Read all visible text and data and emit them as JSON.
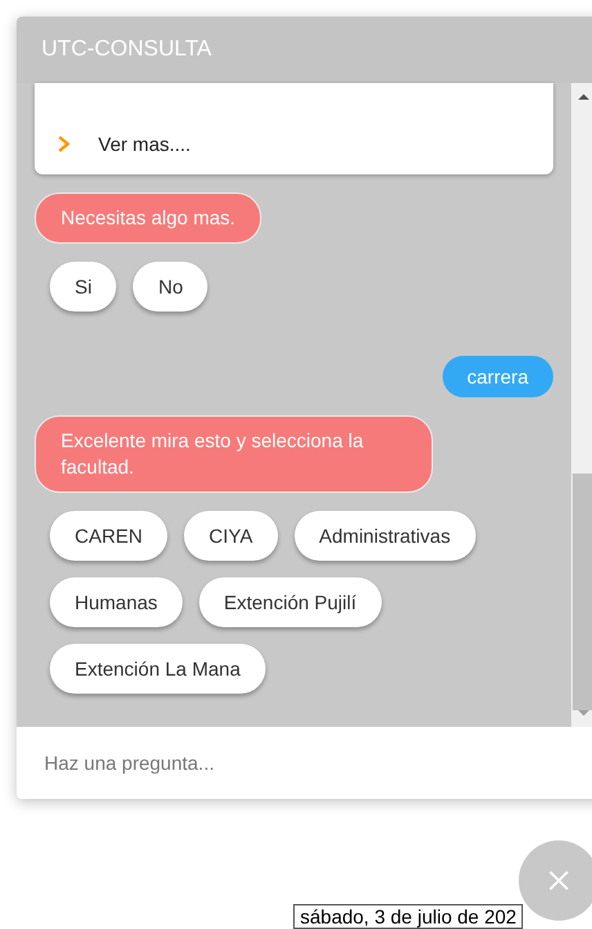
{
  "window": {
    "title": "UTC-CONSULTA"
  },
  "messages": [
    {
      "kind": "link_card",
      "links": [
        {
          "label": "Ver mas...."
        }
      ]
    },
    {
      "kind": "bot",
      "text": "Necesitas algo mas."
    },
    {
      "kind": "options",
      "options": [
        "Si",
        "No"
      ]
    },
    {
      "kind": "user",
      "text": "carrera"
    },
    {
      "kind": "bot",
      "text": "Excelente mira esto y selecciona la facultad."
    },
    {
      "kind": "options",
      "options": [
        "CAREN",
        "CIYA",
        "Administrativas",
        "Humanas",
        "Extención Pujilí",
        "Extención La Mana"
      ]
    }
  ],
  "input": {
    "placeholder": "Haz una pregunta..."
  },
  "date_tooltip": "sábado, 3 de julio de 202"
}
